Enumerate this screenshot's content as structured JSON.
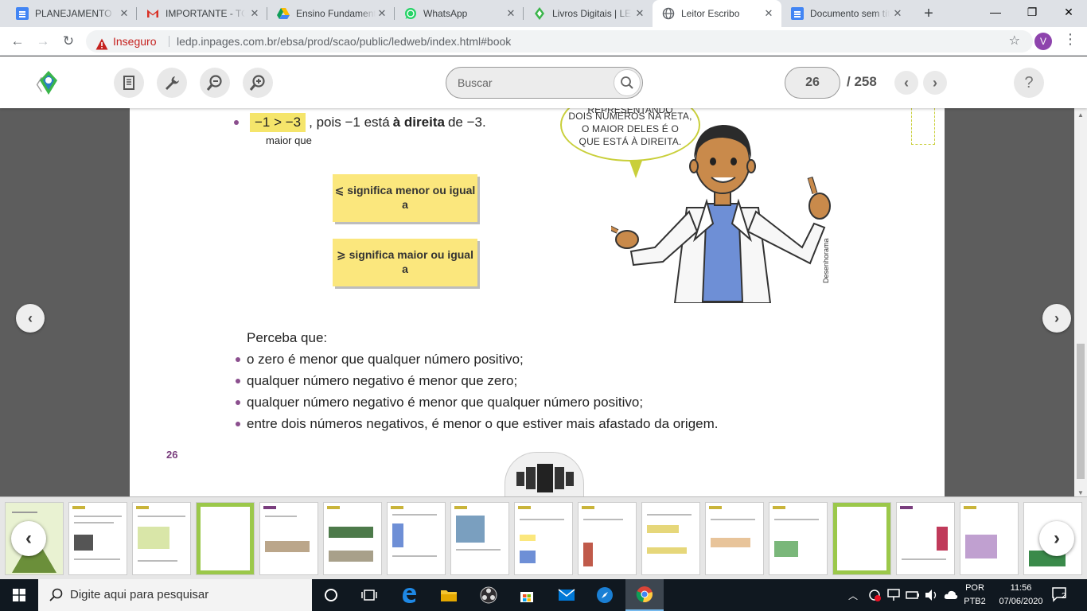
{
  "browser": {
    "tabs": [
      {
        "title": "PLANEJAMENTO SEMANAL",
        "icon": "google-docs-icon",
        "active": false
      },
      {
        "title": "IMPORTANTE - TODOS",
        "icon": "gmail-icon",
        "active": false
      },
      {
        "title": "Ensino Fundamental",
        "icon": "google-drive-icon",
        "active": false
      },
      {
        "title": "WhatsApp",
        "icon": "whatsapp-icon",
        "active": false
      },
      {
        "title": "Livros Digitais | LEDP",
        "icon": "ledp-icon",
        "active": false
      },
      {
        "title": "Leitor Escribo",
        "icon": "globe-icon",
        "active": true
      },
      {
        "title": "Documento sem título",
        "icon": "google-docs-icon",
        "active": false
      }
    ],
    "omnibox": {
      "security_label": "Inseguro",
      "url": "ledp.inpages.com.br/ebsa/prod/scao/public/ledweb/index.html#book"
    },
    "profile_initial": "V"
  },
  "reader": {
    "search_placeholder": "Buscar",
    "current_page": "26",
    "total_pages": "/ 258",
    "help_label": "?"
  },
  "page": {
    "inequality_expr": "−1 > −3",
    "inequality_rest": ", pois −1 está ",
    "inequality_bold": "à direita",
    "inequality_end": " de −3.",
    "maior_que": "maior que",
    "box_le": "⩽ significa menor ou igual a",
    "box_ge": "⩾ significa maior ou igual a",
    "speech_lines": [
      "REPRESENTANDO",
      "DOIS NÚMEROS NA RETA,",
      "O MAIOR DELES É O",
      "QUE ESTÁ À DIREITA."
    ],
    "credit": "Desenhorama",
    "perceba_title": "Perceba que:",
    "perceba_items": [
      "o zero é menor que qualquer número positivo;",
      "qualquer número negativo é menor que zero;",
      "qualquer número negativo é menor que qualquer número positivo;",
      "entre dois números negativos, é menor o que estiver mais afastado da origem."
    ],
    "page_number": "26"
  },
  "taskbar": {
    "search_text": "Digite aqui para pesquisar",
    "lang_top": "POR",
    "lang_bottom": "PTB2",
    "time": "11:56",
    "date": "07/06/2020",
    "notifications": "2"
  },
  "colors": {
    "highlight": "#f5e56b",
    "sign_box": "#fbe77d",
    "accent_purple": "#8b4f8e",
    "speech_border": "#c9cf3a"
  }
}
